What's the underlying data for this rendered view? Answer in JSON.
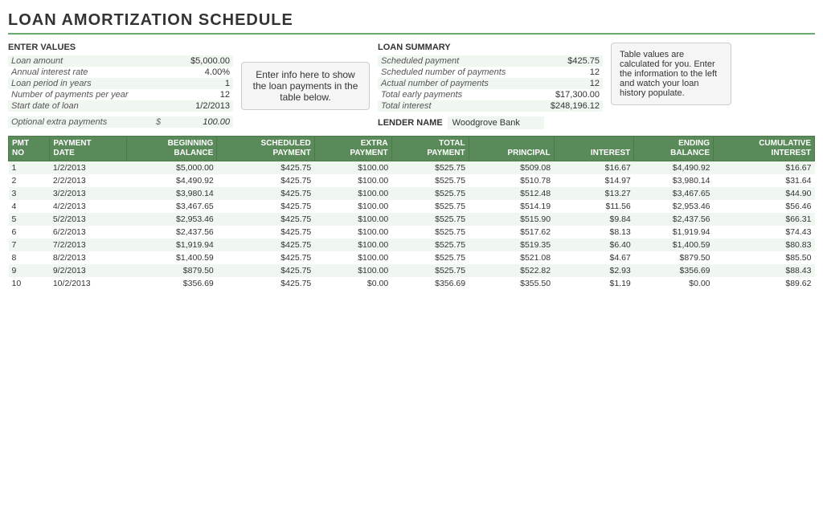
{
  "title": "LOAN AMORTIZATION SCHEDULE",
  "enterValues": {
    "sectionTitle": "ENTER VALUES",
    "fields": [
      {
        "label": "Loan amount",
        "value": "$5,000.00"
      },
      {
        "label": "Annual interest rate",
        "value": "4.00%"
      },
      {
        "label": "Loan period in years",
        "value": "1"
      },
      {
        "label": "Number of payments per year",
        "value": "12"
      },
      {
        "label": "Start date of loan",
        "value": "1/2/2013"
      }
    ],
    "extraLabel": "Optional extra payments",
    "extraSymbol": "$",
    "extraValue": "100.00"
  },
  "infoBubble": "Enter info here to show the loan payments in the table below.",
  "loanSummary": {
    "sectionTitle": "LOAN SUMMARY",
    "fields": [
      {
        "label": "Scheduled payment",
        "value": "$425.75"
      },
      {
        "label": "Scheduled number of payments",
        "value": "12"
      },
      {
        "label": "Actual number of payments",
        "value": "12"
      },
      {
        "label": "Total early payments",
        "value": "$17,300.00"
      },
      {
        "label": "Total interest",
        "value": "$248,196.12"
      }
    ],
    "lenderLabel": "LENDER NAME",
    "lenderValue": "Woodgrove Bank"
  },
  "tipBubble": "Table values are calculated for you. Enter the information to the left and watch your loan history populate.",
  "tableHeaders": [
    {
      "lines": [
        "PMT",
        "NO"
      ],
      "align": "left"
    },
    {
      "lines": [
        "PAYMENT",
        "DATE"
      ],
      "align": "left"
    },
    {
      "lines": [
        "BEGINNING",
        "BALANCE"
      ],
      "align": "right"
    },
    {
      "lines": [
        "SCHEDULED",
        "PAYMENT"
      ],
      "align": "right"
    },
    {
      "lines": [
        "EXTRA",
        "PAYMENT"
      ],
      "align": "right"
    },
    {
      "lines": [
        "TOTAL",
        "PAYMENT"
      ],
      "align": "right"
    },
    {
      "lines": [
        "PRINCIPAL"
      ],
      "align": "right"
    },
    {
      "lines": [
        "INTEREST"
      ],
      "align": "right"
    },
    {
      "lines": [
        "ENDING",
        "BALANCE"
      ],
      "align": "right"
    },
    {
      "lines": [
        "CUMULATIVE",
        "INTEREST"
      ],
      "align": "right"
    }
  ],
  "tableRows": [
    {
      "pmt": "1",
      "date": "1/2/2013",
      "beg": "$5,000.00",
      "sched": "$425.75",
      "extra": "$100.00",
      "total": "$525.75",
      "principal": "$509.08",
      "interest": "$16.67",
      "ending": "$4,490.92",
      "cumint": "$16.67"
    },
    {
      "pmt": "2",
      "date": "2/2/2013",
      "beg": "$4,490.92",
      "sched": "$425.75",
      "extra": "$100.00",
      "total": "$525.75",
      "principal": "$510.78",
      "interest": "$14.97",
      "ending": "$3,980.14",
      "cumint": "$31.64"
    },
    {
      "pmt": "3",
      "date": "3/2/2013",
      "beg": "$3,980.14",
      "sched": "$425.75",
      "extra": "$100.00",
      "total": "$525.75",
      "principal": "$512.48",
      "interest": "$13.27",
      "ending": "$3,467.65",
      "cumint": "$44.90"
    },
    {
      "pmt": "4",
      "date": "4/2/2013",
      "beg": "$3,467.65",
      "sched": "$425.75",
      "extra": "$100.00",
      "total": "$525.75",
      "principal": "$514.19",
      "interest": "$11.56",
      "ending": "$2,953.46",
      "cumint": "$56.46"
    },
    {
      "pmt": "5",
      "date": "5/2/2013",
      "beg": "$2,953.46",
      "sched": "$425.75",
      "extra": "$100.00",
      "total": "$525.75",
      "principal": "$515.90",
      "interest": "$9.84",
      "ending": "$2,437.56",
      "cumint": "$66.31"
    },
    {
      "pmt": "6",
      "date": "6/2/2013",
      "beg": "$2,437.56",
      "sched": "$425.75",
      "extra": "$100.00",
      "total": "$525.75",
      "principal": "$517.62",
      "interest": "$8.13",
      "ending": "$1,919.94",
      "cumint": "$74.43"
    },
    {
      "pmt": "7",
      "date": "7/2/2013",
      "beg": "$1,919.94",
      "sched": "$425.75",
      "extra": "$100.00",
      "total": "$525.75",
      "principal": "$519.35",
      "interest": "$6.40",
      "ending": "$1,400.59",
      "cumint": "$80.83"
    },
    {
      "pmt": "8",
      "date": "8/2/2013",
      "beg": "$1,400.59",
      "sched": "$425.75",
      "extra": "$100.00",
      "total": "$525.75",
      "principal": "$521.08",
      "interest": "$4.67",
      "ending": "$879.50",
      "cumint": "$85.50"
    },
    {
      "pmt": "9",
      "date": "9/2/2013",
      "beg": "$879.50",
      "sched": "$425.75",
      "extra": "$100.00",
      "total": "$525.75",
      "principal": "$522.82",
      "interest": "$2.93",
      "ending": "$356.69",
      "cumint": "$88.43"
    },
    {
      "pmt": "10",
      "date": "10/2/2013",
      "beg": "$356.69",
      "sched": "$425.75",
      "extra": "$0.00",
      "total": "$356.69",
      "principal": "$355.50",
      "interest": "$1.19",
      "ending": "$0.00",
      "cumint": "$89.62"
    }
  ]
}
